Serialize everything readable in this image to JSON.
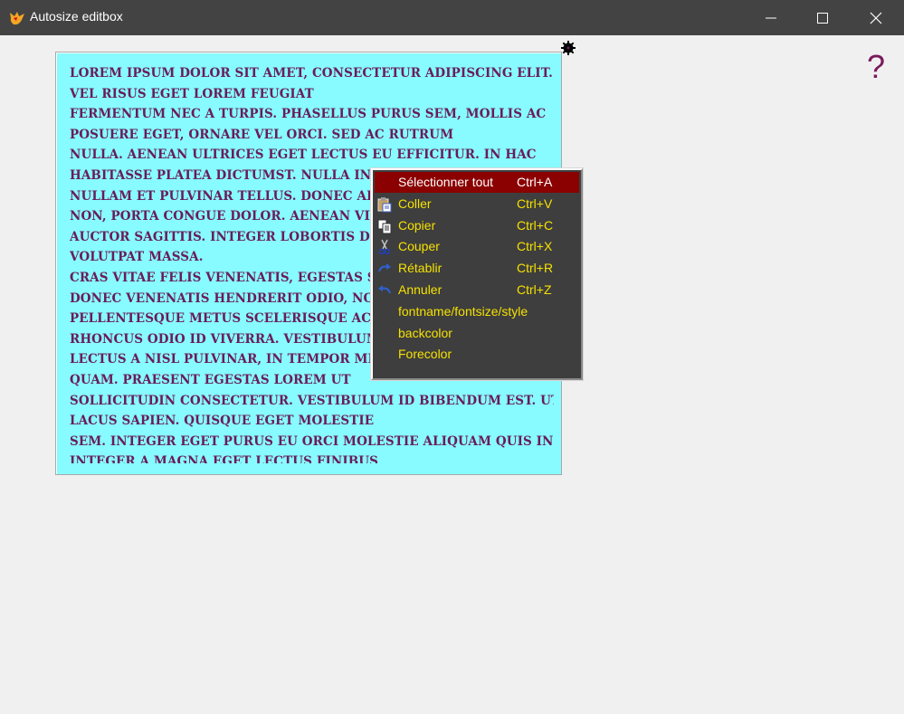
{
  "window": {
    "title": "Autosize editbox"
  },
  "help": {
    "glyph": "?"
  },
  "editbox": {
    "background_color": "#87fbff",
    "text_color": "#6a1c5a",
    "lines": [
      "Lorem ipsum dolor sit amet, consectetur adipiscing elit. Proin",
      "vel risus eget lorem feugiat",
      "fermentum nec a turpis. Phasellus purus sem, mollis ac",
      "posuere eget, ornare vel orci. Sed ac rutrum",
      "nulla. Aenean ultrices eget lectus eu efficitur. In hac",
      "habitasse platea dictumst. Nulla in ia",
      "nullam et pulvinar tellus. Donec arcu",
      "non, porta congue dolor. Aenean viver",
      "auctor sagittis. Integer lobortis digni",
      "volutpat massa.",
      "Cras vitae felis venenatis, egestas sem",
      "donec venenatis hendrerit odio, non",
      "pellentesque metus scelerisque ac. Sus",
      "rhoncus odio id viverra. Vestibulum feu",
      "lectus a nisl pulvinar, in tempor metus",
      "quam. Praesent egestas lorem ut",
      "sollicitudin consectetur. Vestibulum id bibendum est. Ut vel",
      "lacus sapien. Quisque eget molestie",
      "sem. Integer eget purus eu orci molestie aliquam quis in ante.",
      "Integer a magna eget lectus finibus"
    ]
  },
  "context_menu": {
    "background_color": "#3e3e3e",
    "text_color": "#f5e100",
    "highlight_color": "#8b0000",
    "items": [
      {
        "label": "Sélectionner tout",
        "shortcut": "Ctrl+A",
        "icon": "none",
        "selected": true
      },
      {
        "label": "Coller",
        "shortcut": "Ctrl+V",
        "icon": "paste-icon",
        "selected": false
      },
      {
        "label": "Copier",
        "shortcut": "Ctrl+C",
        "icon": "copy-icon",
        "selected": false
      },
      {
        "label": "Couper",
        "shortcut": "Ctrl+X",
        "icon": "scissors-icon",
        "selected": false
      },
      {
        "label": "Rétablir",
        "shortcut": "Ctrl+R",
        "icon": "redo-icon",
        "selected": false
      },
      {
        "label": "Annuler",
        "shortcut": "Ctrl+Z",
        "icon": "undo-icon",
        "selected": false
      },
      {
        "label": "fontname/fontsize/style",
        "shortcut": "",
        "icon": "none",
        "selected": false
      },
      {
        "label": "backcolor",
        "shortcut": "",
        "icon": "none",
        "selected": false
      },
      {
        "label": "Forecolor",
        "shortcut": "",
        "icon": "none",
        "selected": false
      }
    ]
  }
}
